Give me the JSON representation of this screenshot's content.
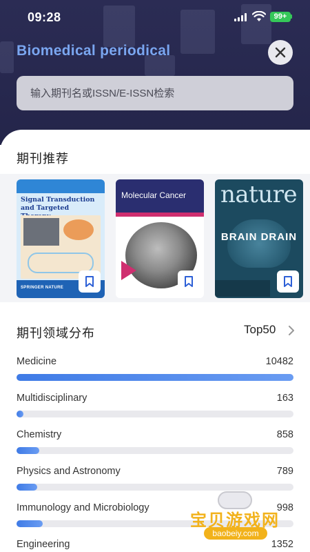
{
  "status_bar": {
    "time": "09:28",
    "battery": "99+",
    "icons": [
      "signal-icon",
      "wifi-icon",
      "battery-icon"
    ]
  },
  "header": {
    "title": "Biomedical periodical",
    "close_icon": "close-icon"
  },
  "search": {
    "placeholder": "输入期刊名或ISSN/E-ISSN检索"
  },
  "recommend": {
    "title": "期刊推荐",
    "journals": [
      {
        "cover_title": "Signal Transduction and Targeted Therapy",
        "publisher": "SPRINGER NATURE",
        "icon": "bookmark-icon"
      },
      {
        "cover_title": "Molecular Cancer",
        "icon": "bookmark-icon"
      },
      {
        "cover_title": "nature",
        "headline": "BRAIN DRAIN",
        "icon": "bookmark-icon"
      }
    ]
  },
  "distribution": {
    "title": "期刊领域分布",
    "link_label": "Top50",
    "link_icon": "chevron-right-icon",
    "items": [
      {
        "label": "Medicine",
        "value": "10482",
        "fill": 1.0
      },
      {
        "label": "Multidisciplinary",
        "value": "163",
        "fill": 0.016
      },
      {
        "label": "Chemistry",
        "value": "858",
        "fill": 0.082
      },
      {
        "label": "Physics and Astronomy",
        "value": "789",
        "fill": 0.075
      },
      {
        "label": "Immunology and Microbiology",
        "value": "998",
        "fill": 0.095
      },
      {
        "label": "Engineering",
        "value": "1352",
        "fill": 0.129
      }
    ]
  },
  "watermark": {
    "text": "宝贝游戏网",
    "url": "baobeiy.com"
  },
  "colors": {
    "header_bg": "#2b2c54",
    "title": "#7aa6f0",
    "bar_fill": "#3f7be6",
    "bar_track": "#e9e9ed",
    "battery": "#35c759"
  }
}
